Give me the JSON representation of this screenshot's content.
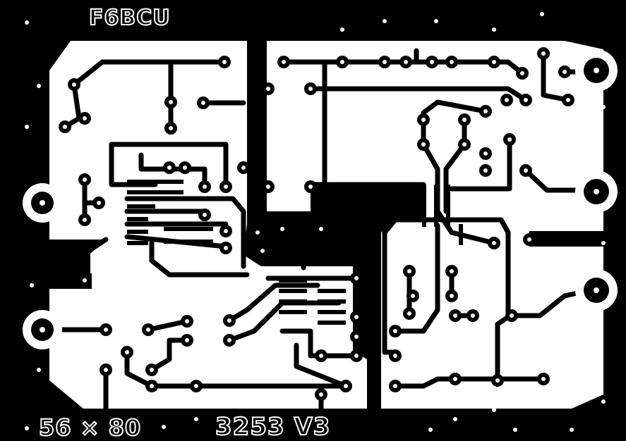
{
  "board": {
    "title": "F6BCU",
    "size": "56 × 80",
    "code": "3253 V3"
  },
  "colors": {
    "background": "#000000",
    "copper": "#ffffff",
    "hole": "#000000"
  }
}
